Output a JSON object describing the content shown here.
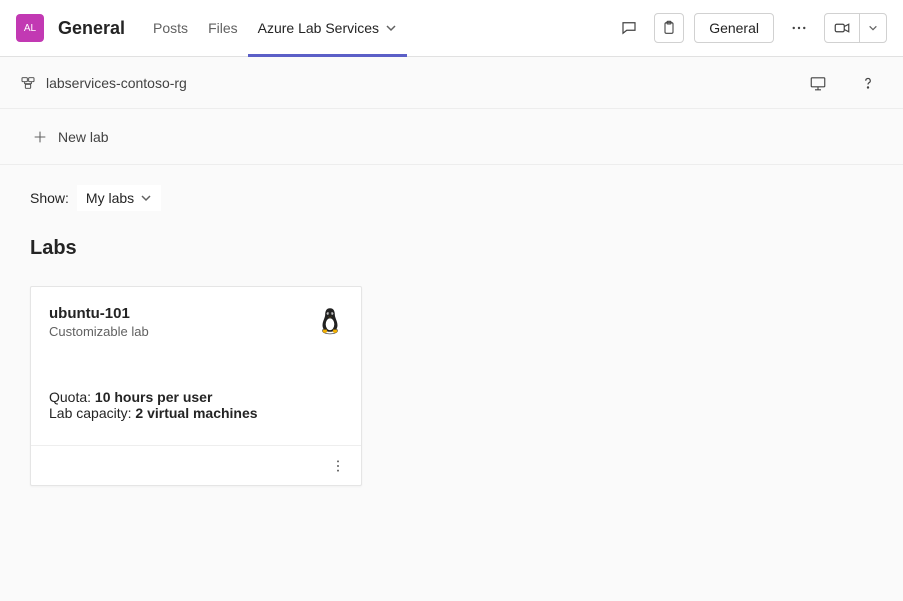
{
  "header": {
    "avatar_initials": "AL",
    "channel_title": "General",
    "tabs": {
      "posts": "Posts",
      "files": "Files",
      "active": "Azure Lab Services"
    },
    "general_btn": "General"
  },
  "breadcrumb": {
    "resource_group": "labservices-contoso-rg"
  },
  "toolbar": {
    "new_lab": "New lab"
  },
  "filter": {
    "show_label": "Show:",
    "show_value": "My labs"
  },
  "section": {
    "title": "Labs"
  },
  "labs": [
    {
      "name": "ubuntu-101",
      "subtitle": "Customizable lab",
      "os_icon": "tux-icon",
      "quota_label": "Quota: ",
      "quota_value": "10 hours per user",
      "capacity_label": "Lab capacity: ",
      "capacity_value": "2 virtual machines"
    }
  ]
}
